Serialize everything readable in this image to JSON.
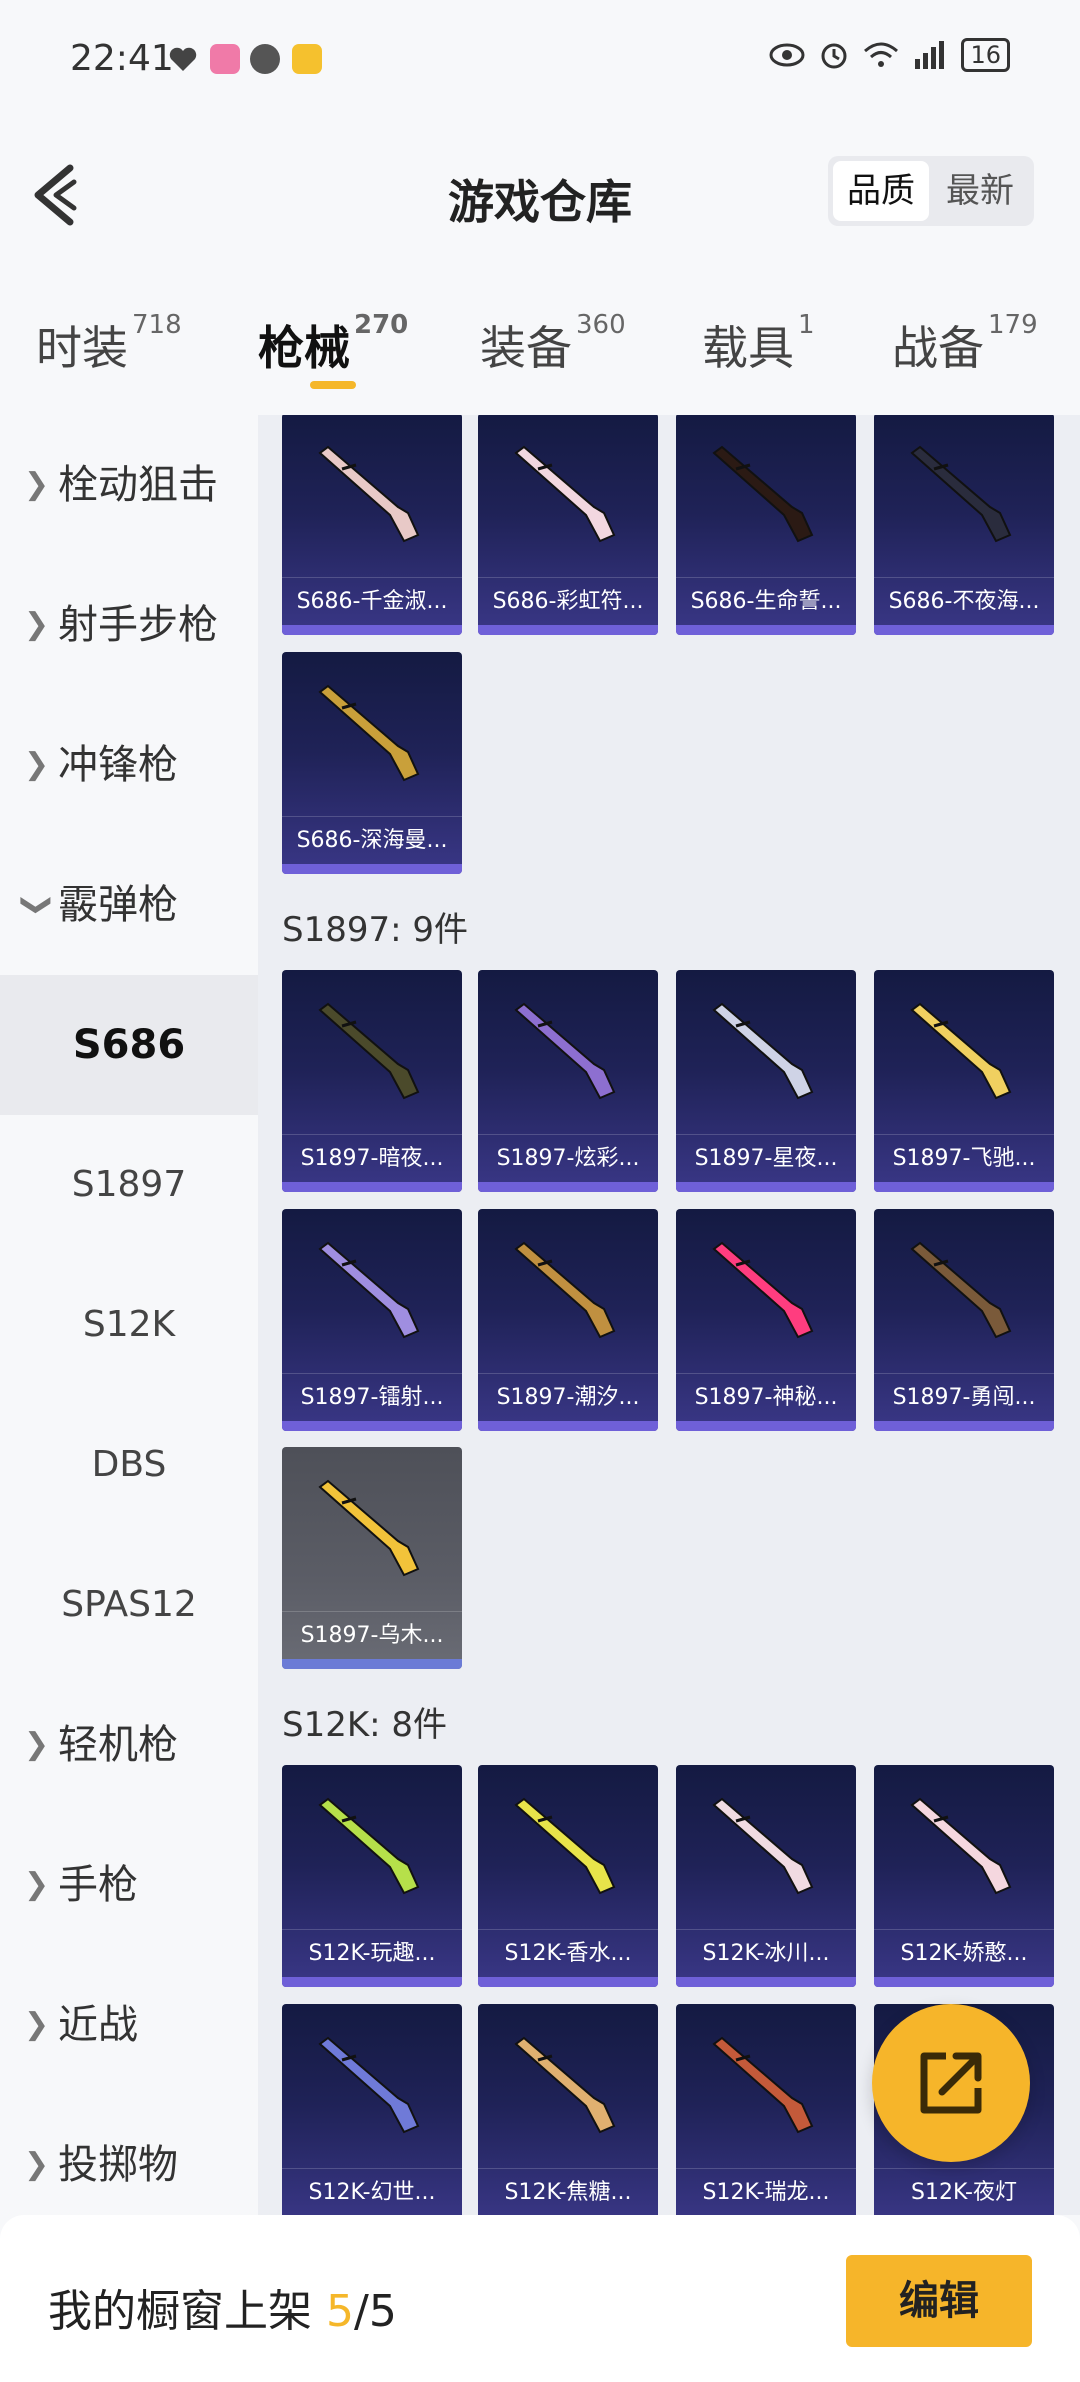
{
  "status_bar": {
    "time": "22:41",
    "battery": "16",
    "icons": [
      "heart-icon",
      "app-icon",
      "chat-icon",
      "mail-icon",
      "eye-icon",
      "alarm-icon",
      "wifi-icon",
      "signal-icon",
      "battery-icon"
    ]
  },
  "header": {
    "title": "游戏仓库",
    "sort_options": [
      "品质",
      "最新"
    ],
    "sort_selected": "品质"
  },
  "tabs": [
    {
      "label": "时装",
      "count": "718"
    },
    {
      "label": "枪械",
      "count": "270",
      "active": true
    },
    {
      "label": "装备",
      "count": "360"
    },
    {
      "label": "载具",
      "count": "1"
    },
    {
      "label": "战备",
      "count": "179"
    }
  ],
  "sidebar": {
    "categories": [
      {
        "label": "栓动狙击"
      },
      {
        "label": "射手步枪"
      },
      {
        "label": "冲锋枪"
      },
      {
        "label": "霰弹枪",
        "expanded": true
      },
      {
        "label": "轻机枪"
      },
      {
        "label": "手枪"
      },
      {
        "label": "近战"
      },
      {
        "label": "投掷物"
      }
    ],
    "subcategories": [
      {
        "label": "S686",
        "active": true
      },
      {
        "label": "S1897"
      },
      {
        "label": "S12K"
      },
      {
        "label": "DBS"
      },
      {
        "label": "SPAS12"
      }
    ]
  },
  "groups": [
    {
      "label": "",
      "items": [
        "S686-千金淑...",
        "S686-彩虹符...",
        "S686-生命誓...",
        "S686-不夜海...",
        "S686-深海曼..."
      ]
    },
    {
      "label": "S1897: 9件",
      "items": [
        "S1897-暗夜...",
        "S1897-炫彩...",
        "S1897-星夜...",
        "S1897-飞驰...",
        "S1897-镭射...",
        "S1897-潮汐...",
        "S1897-神秘...",
        "S1897-勇闯...",
        "S1897-乌木..."
      ]
    },
    {
      "label": "S12K: 8件",
      "items": [
        "S12K-玩趣...",
        "S12K-香水...",
        "S12K-冰川...",
        "S12K-娇憨...",
        "S12K-幻世...",
        "S12K-焦糖...",
        "S12K-瑞龙...",
        "S12K-夜灯"
      ]
    }
  ],
  "bottom_bar": {
    "showcase_label": "我的橱窗上架",
    "showcase_count": "5",
    "showcase_total": "/5",
    "edit_label": "编辑"
  },
  "colors": {
    "accent": "#f6b52a",
    "card_top": "#141a42",
    "card_bottom": "#3a3787",
    "card_bar": "#6f60d8"
  }
}
